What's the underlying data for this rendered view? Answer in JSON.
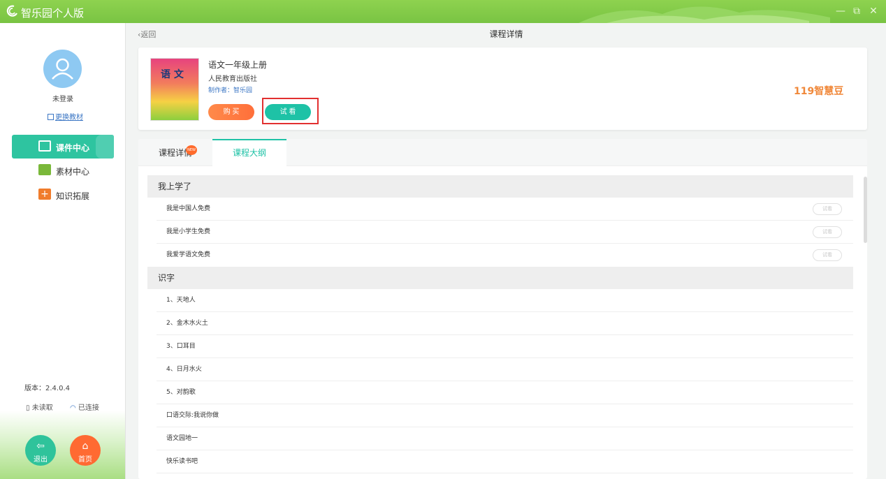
{
  "titlebar": {
    "app_title": "智乐园个人版",
    "minimize": "—",
    "restore": "⧉",
    "close": "✕"
  },
  "sidebar": {
    "login_status": "未登录",
    "change_book": "更换教材",
    "nav": [
      {
        "label": "课件中心",
        "icon": "courseware-icon",
        "color": "#ffffff"
      },
      {
        "label": "素材中心",
        "icon": "folder-icon",
        "color": "#7ab83a"
      },
      {
        "label": "知识拓展",
        "icon": "plus-box-icon",
        "color": "#f07c2c"
      }
    ],
    "version": "版本：2.4.0.4",
    "reader_status": "未读取",
    "network_status": "已连接",
    "exit_label": "退出",
    "home_label": "首页"
  },
  "header": {
    "back": "返回",
    "title": "课程详情"
  },
  "course": {
    "cover_text": "语 文",
    "name": "语文一年级上册",
    "publisher": "人民教育出版社",
    "maker": "制作者：智乐园",
    "buy_label": "购 买",
    "trial_label": "试 看",
    "price": "119智慧豆"
  },
  "tabs": {
    "details": "课程详情",
    "details_badge": "NEW",
    "outline": "课程大纲"
  },
  "outline": {
    "trial_label": "试看",
    "sections": [
      {
        "title": "我上学了",
        "lessons": [
          "我是中国人免费",
          "我是小学生免费",
          "我爱学语文免费"
        ]
      },
      {
        "title": "识字",
        "lessons": [
          "1、天地人",
          "2、金木水火土",
          "3、口耳目",
          "4、日月水火",
          "5、对韵歌",
          "口语交际:我说你做",
          "语文园地一",
          "快乐读书吧"
        ]
      }
    ]
  },
  "colors": {
    "accent": "#1ec2a6",
    "brand_green": "#79c443",
    "price": "#f0883a",
    "buy": "#ff7a3e",
    "highlight_frame": "#e23030"
  }
}
